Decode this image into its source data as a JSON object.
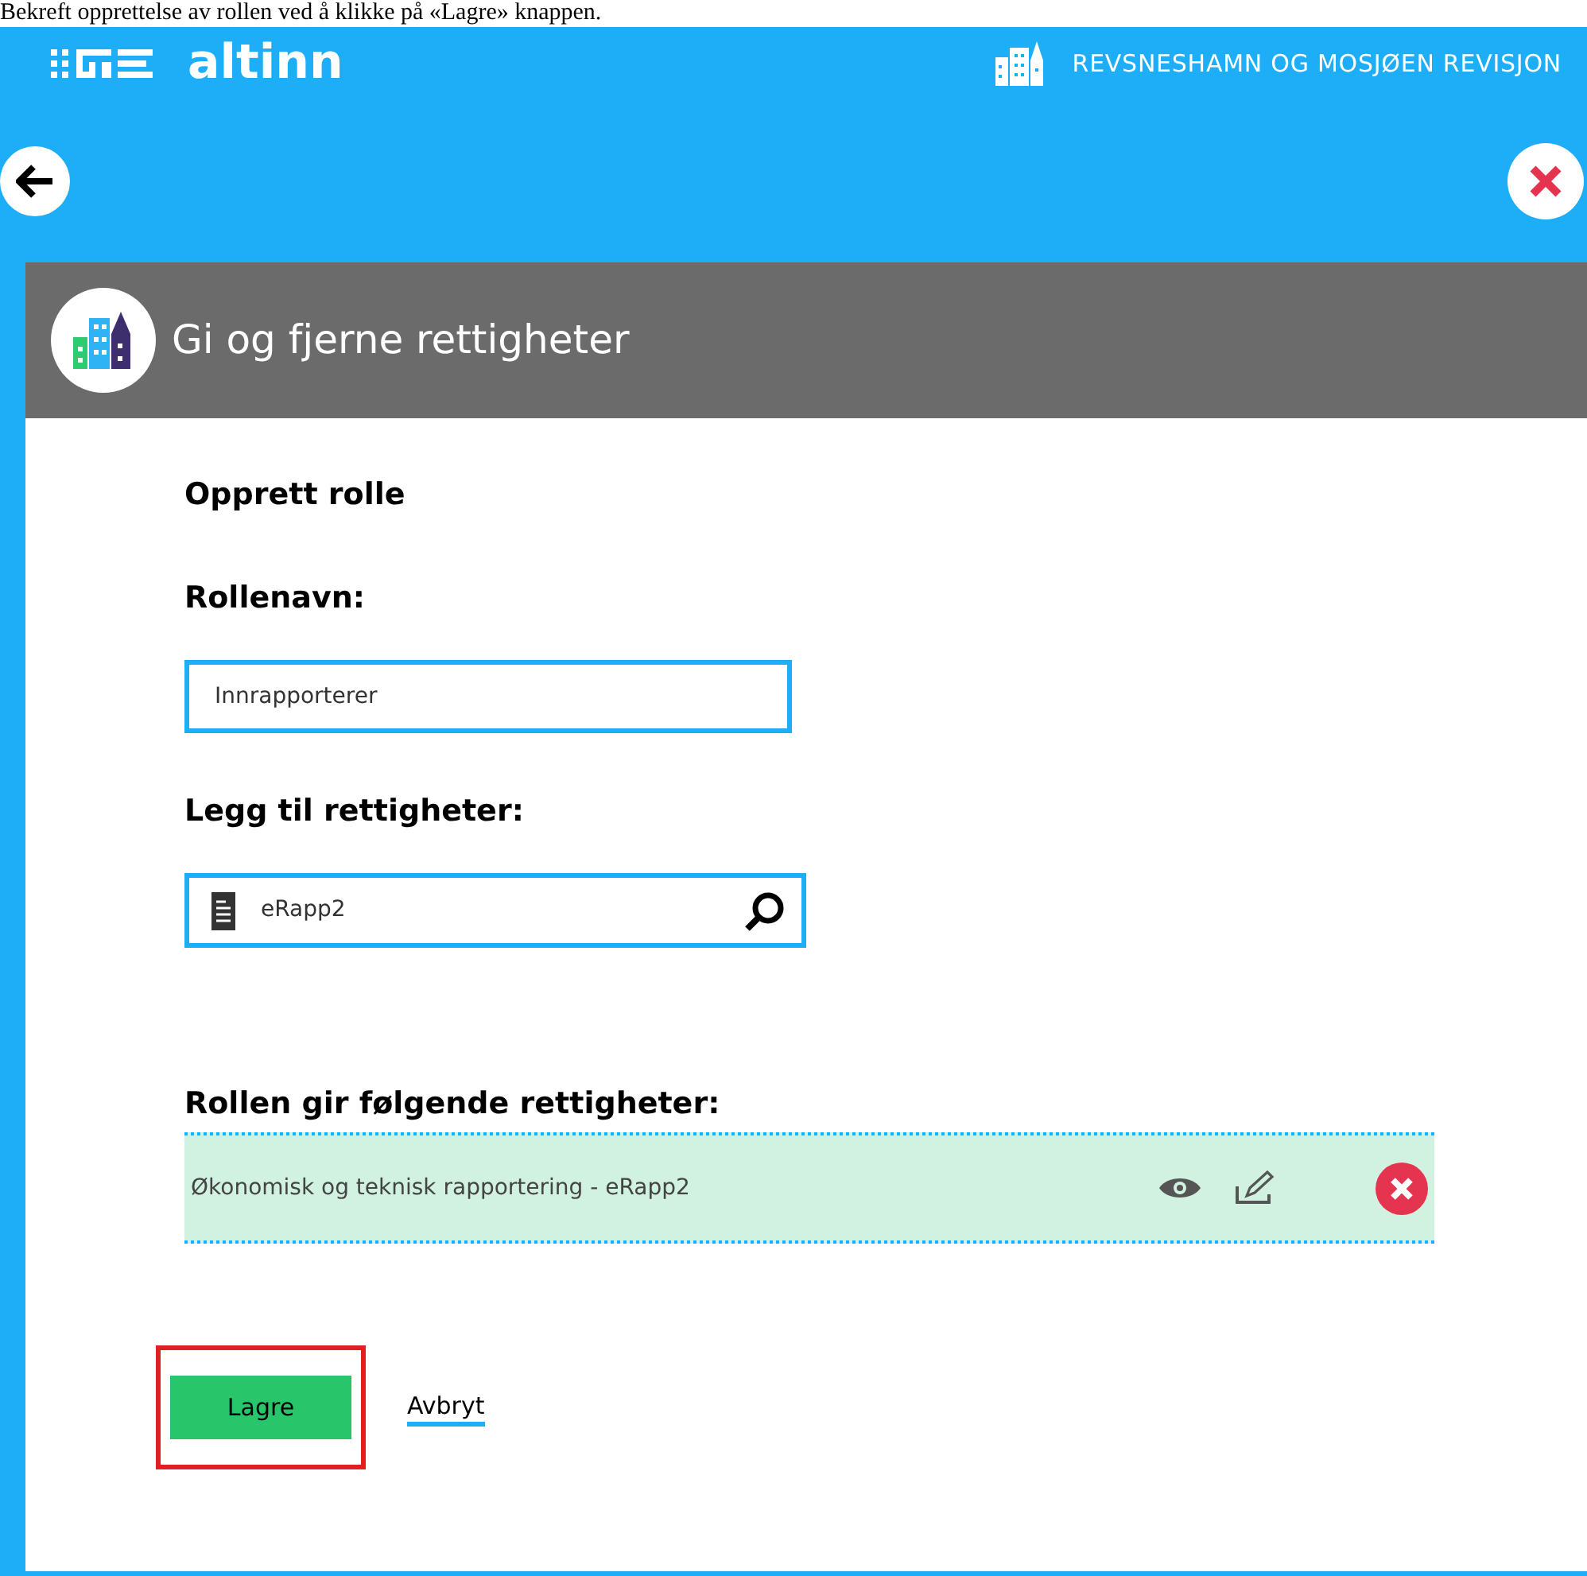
{
  "caption": "Bekreft opprettelse av rollen ved å klikke på «Lagre» knappen.",
  "header": {
    "logo": "altinn",
    "organization": "REVSNESHAMN OG MOSJØEN REVISJON"
  },
  "panel": {
    "title": "Gi og fjerne rettigheter"
  },
  "form": {
    "heading": "Opprett rolle",
    "role_name": {
      "label": "Rollenavn:",
      "value": "Innrapporterer"
    },
    "add_rights": {
      "label": "Legg til rettigheter:",
      "value": "eRapp2"
    },
    "rights": {
      "label": "Rollen gir følgende rettigheter:",
      "items": [
        {
          "text": "Økonomisk og teknisk rapportering - eRapp2"
        }
      ]
    }
  },
  "actions": {
    "save": {
      "label": "Lagre",
      "highlighted": true
    },
    "cancel": "Avbryt"
  }
}
